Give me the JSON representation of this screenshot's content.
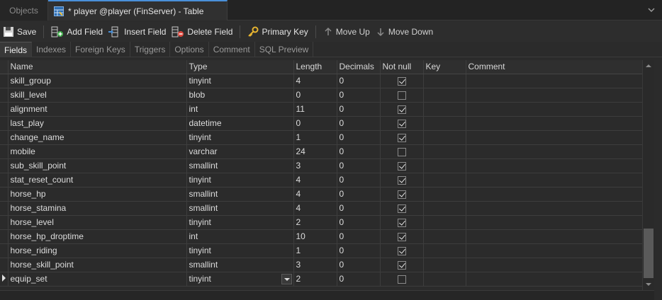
{
  "tabs": {
    "objects": "Objects",
    "table": "* player @player (FinServer) - Table"
  },
  "toolbar": {
    "save": "Save",
    "add_field": "Add Field",
    "insert_field": "Insert Field",
    "delete_field": "Delete Field",
    "primary_key": "Primary Key",
    "move_up": "Move Up",
    "move_down": "Move Down"
  },
  "subtabs": [
    "Fields",
    "Indexes",
    "Foreign Keys",
    "Triggers",
    "Options",
    "Comment",
    "SQL Preview"
  ],
  "columns": {
    "name": "Name",
    "type": "Type",
    "length": "Length",
    "decimals": "Decimals",
    "not_null": "Not null",
    "key": "Key",
    "comment": "Comment"
  },
  "rows": [
    {
      "name": "skill_group",
      "type": "tinyint",
      "length": "4",
      "decimals": "0",
      "not_null": true
    },
    {
      "name": "skill_level",
      "type": "blob",
      "length": "0",
      "decimals": "0",
      "not_null": false
    },
    {
      "name": "alignment",
      "type": "int",
      "length": "11",
      "decimals": "0",
      "not_null": true
    },
    {
      "name": "last_play",
      "type": "datetime",
      "length": "0",
      "decimals": "0",
      "not_null": true
    },
    {
      "name": "change_name",
      "type": "tinyint",
      "length": "1",
      "decimals": "0",
      "not_null": true
    },
    {
      "name": "mobile",
      "type": "varchar",
      "length": "24",
      "decimals": "0",
      "not_null": false
    },
    {
      "name": "sub_skill_point",
      "type": "smallint",
      "length": "3",
      "decimals": "0",
      "not_null": true
    },
    {
      "name": "stat_reset_count",
      "type": "tinyint",
      "length": "4",
      "decimals": "0",
      "not_null": true
    },
    {
      "name": "horse_hp",
      "type": "smallint",
      "length": "4",
      "decimals": "0",
      "not_null": true
    },
    {
      "name": "horse_stamina",
      "type": "smallint",
      "length": "4",
      "decimals": "0",
      "not_null": true
    },
    {
      "name": "horse_level",
      "type": "tinyint",
      "length": "2",
      "decimals": "0",
      "not_null": true
    },
    {
      "name": "horse_hp_droptime",
      "type": "int",
      "length": "10",
      "decimals": "0",
      "not_null": true
    },
    {
      "name": "horse_riding",
      "type": "tinyint",
      "length": "1",
      "decimals": "0",
      "not_null": true
    },
    {
      "name": "horse_skill_point",
      "type": "smallint",
      "length": "3",
      "decimals": "0",
      "not_null": true
    },
    {
      "name": "equip_set",
      "type": "tinyint",
      "length": "2",
      "decimals": "0",
      "not_null": false,
      "current": true
    }
  ]
}
